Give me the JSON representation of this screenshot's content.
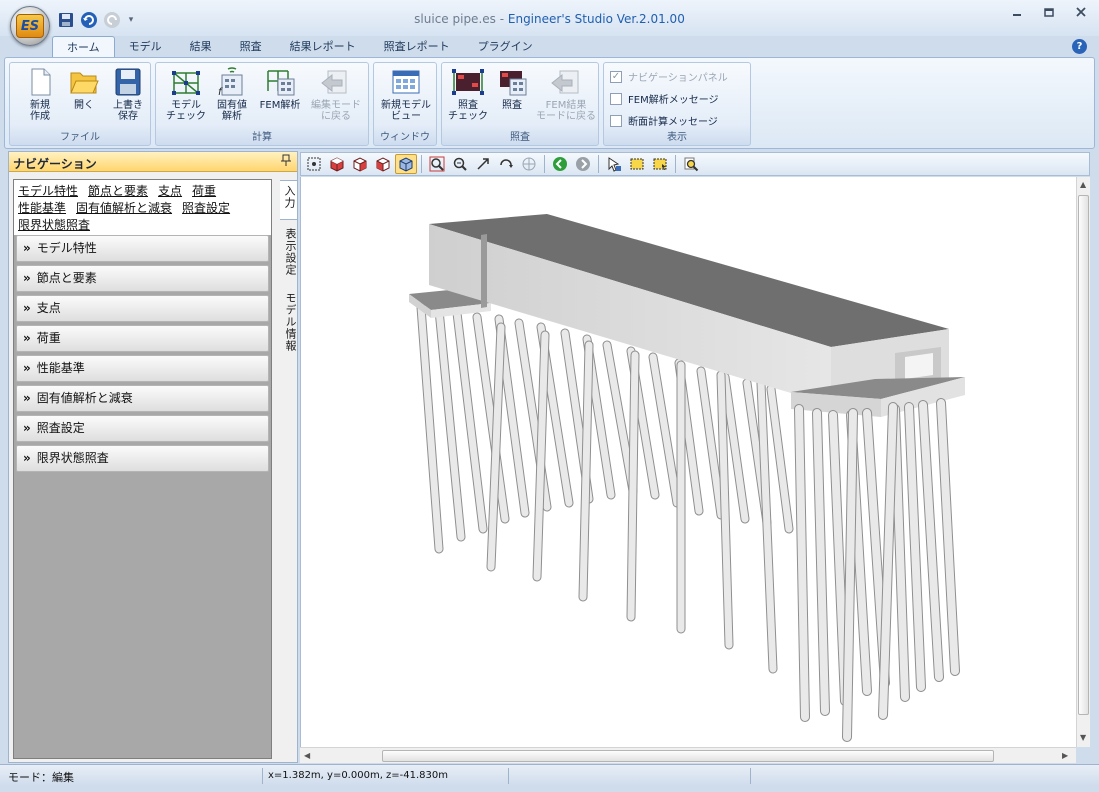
{
  "window": {
    "file_name": "sluice pipe.es",
    "separator": " - ",
    "product": "Engineer's Studio Ver.2.01.00",
    "app_logo": "ES"
  },
  "icons": {
    "qat": [
      "save-icon",
      "undo-icon",
      "redo-icon",
      "qat-menu-icon"
    ],
    "window": [
      "minimize-icon",
      "restore-icon",
      "close-icon"
    ]
  },
  "tabs": [
    {
      "label": "ホーム",
      "active": true
    },
    {
      "label": "モデル"
    },
    {
      "label": "結果"
    },
    {
      "label": "照査"
    },
    {
      "label": "結果レポート"
    },
    {
      "label": "照査レポート"
    },
    {
      "label": "プラグイン"
    }
  ],
  "ribbon": {
    "file_group": {
      "label": "ファイル",
      "new_line1": "新規",
      "new_line2": "作成",
      "open_line1": "開く",
      "save_line1": "上書き",
      "save_line2": "保存"
    },
    "calc_group": {
      "label": "計算",
      "model_check_line1": "モデル",
      "model_check_line2": "チェック",
      "eigen_line1": "固有値",
      "eigen_line2": "解析",
      "fem_line1": "FEM解析",
      "edit_mode_line1": "編集モード",
      "edit_mode_line2": "に戻る"
    },
    "window_group": {
      "label": "ウィンドウ",
      "new_view_line1": "新規モデル",
      "new_view_line2": "ビュー"
    },
    "check_group": {
      "label": "照査",
      "check_check_line1": "照査",
      "check_check_line2": "チェック",
      "check_line1": "照査",
      "fem_back_line1": "FEM結果",
      "fem_back_line2": "モードに戻る"
    },
    "display_group": {
      "label": "表示",
      "nav_panel": "ナビゲーションパネル",
      "fem_message": "FEM解析メッセージ",
      "section_message": "断面計算メッセージ"
    }
  },
  "navigation": {
    "title": "ナビゲーション",
    "links": [
      "モデル特性",
      "節点と要素",
      "支点",
      "荷重",
      "性能基準",
      "固有値解析と減衰",
      "照査設定",
      "限界状態照査"
    ],
    "sections": [
      "モデル特性",
      "節点と要素",
      "支点",
      "荷重",
      "性能基準",
      "固有値解析と減衰",
      "照査設定",
      "限界状態照査"
    ],
    "chevron": "»",
    "side_tabs": [
      "入力",
      "表示設定",
      "モデル情報"
    ]
  },
  "viewport_toolbar": [
    "select-all-icon",
    "cube-iso-icon",
    "cube-front-icon",
    "cube-side-icon",
    "cube-perspective-icon",
    "zoom-window-icon",
    "zoom-out-icon",
    "fit-arrow-icon",
    "rotate-icon",
    "pan-icon",
    "back-icon",
    "forward-icon",
    "pointer-icon",
    "select-box-icon",
    "select-box2-icon",
    "find-icon"
  ],
  "status": {
    "mode": "モード：編集",
    "coords": "x=1.382m, y=0.000m, z=-41.830m"
  },
  "colors": {
    "accent": "#1f5fb0",
    "nav_header": "#ffd56e",
    "model_face": "#d9d9d9",
    "model_top": "#707070"
  }
}
